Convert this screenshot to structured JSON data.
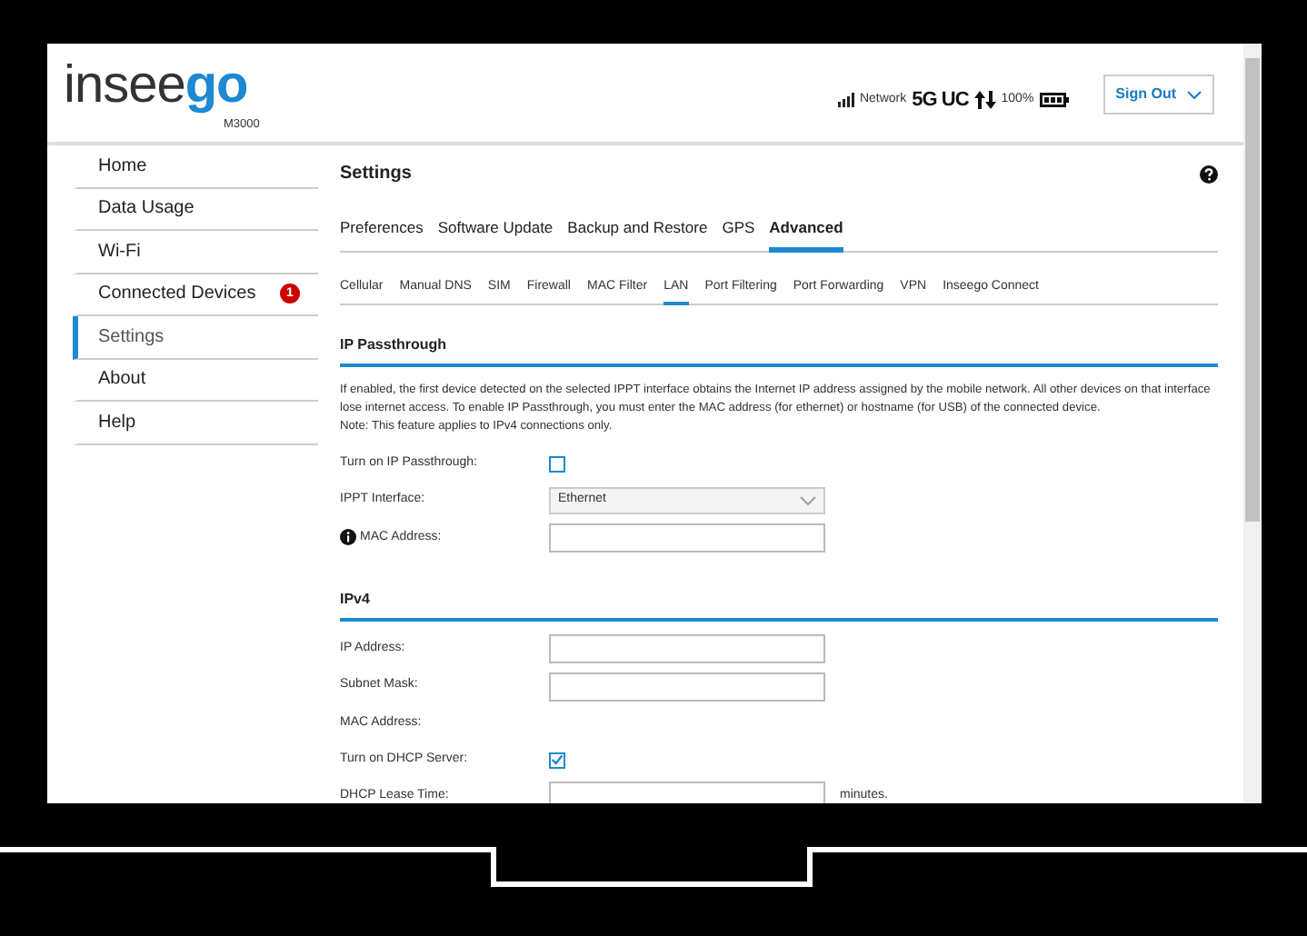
{
  "header": {
    "logo": {
      "lead": "insee",
      "accent": "go"
    },
    "model": "M3000",
    "status": {
      "network_label": "Network",
      "network_type": "5G UC",
      "battery": "100%"
    },
    "sign_out": "Sign Out"
  },
  "sidebar": {
    "items": [
      {
        "label": "Home",
        "selected": false
      },
      {
        "label": "Data Usage",
        "selected": false
      },
      {
        "label": "Wi-Fi",
        "selected": false
      },
      {
        "label": "Connected Devices",
        "selected": false,
        "badge": "1"
      },
      {
        "label": "Settings",
        "selected": true
      },
      {
        "label": "About",
        "selected": false
      },
      {
        "label": "Help",
        "selected": false
      }
    ]
  },
  "page_title": "Settings",
  "tabs": [
    {
      "label": "Preferences",
      "selected": false
    },
    {
      "label": "Software Update",
      "selected": false
    },
    {
      "label": "Backup and Restore",
      "selected": false
    },
    {
      "label": "GPS",
      "selected": false
    },
    {
      "label": "Advanced",
      "selected": true
    }
  ],
  "subtabs": [
    {
      "label": "Cellular",
      "selected": false
    },
    {
      "label": "Manual DNS",
      "selected": false
    },
    {
      "label": "SIM",
      "selected": false
    },
    {
      "label": "Firewall",
      "selected": false
    },
    {
      "label": "MAC Filter",
      "selected": false
    },
    {
      "label": "LAN",
      "selected": true
    },
    {
      "label": "Port Filtering",
      "selected": false
    },
    {
      "label": "Port Forwarding",
      "selected": false
    },
    {
      "label": "VPN",
      "selected": false
    },
    {
      "label": "Inseego Connect",
      "selected": false
    }
  ],
  "sections": [
    {
      "title": "IP Passthrough",
      "description": [
        "If enabled, the first device detected on the selected IPPT interface obtains the Internet IP address assigned by the mobile network. All other devices on that interface lose internet access. To enable IP Passthrough, you must enter the MAC address (for ethernet) or hostname (for USB) of the connected device.",
        "Note: This feature applies to IPv4 connections only."
      ],
      "fields": [
        {
          "kind": "checkbox",
          "label": "Turn on IP Passthrough:",
          "checked": false
        },
        {
          "kind": "select",
          "label": "IPPT Interface:",
          "value": "Ethernet"
        },
        {
          "kind": "text",
          "label": "MAC Address:",
          "info": true
        }
      ]
    },
    {
      "title": "IPv4",
      "fields": [
        {
          "kind": "text",
          "label": "IP Address:"
        },
        {
          "kind": "text",
          "label": "Subnet Mask:"
        },
        {
          "kind": "static",
          "label": "MAC Address:"
        },
        {
          "kind": "checkbox",
          "label": "Turn on DHCP Server:",
          "checked": true
        },
        {
          "kind": "text",
          "label": "DHCP Lease Time:",
          "suffix": "minutes."
        }
      ]
    }
  ]
}
